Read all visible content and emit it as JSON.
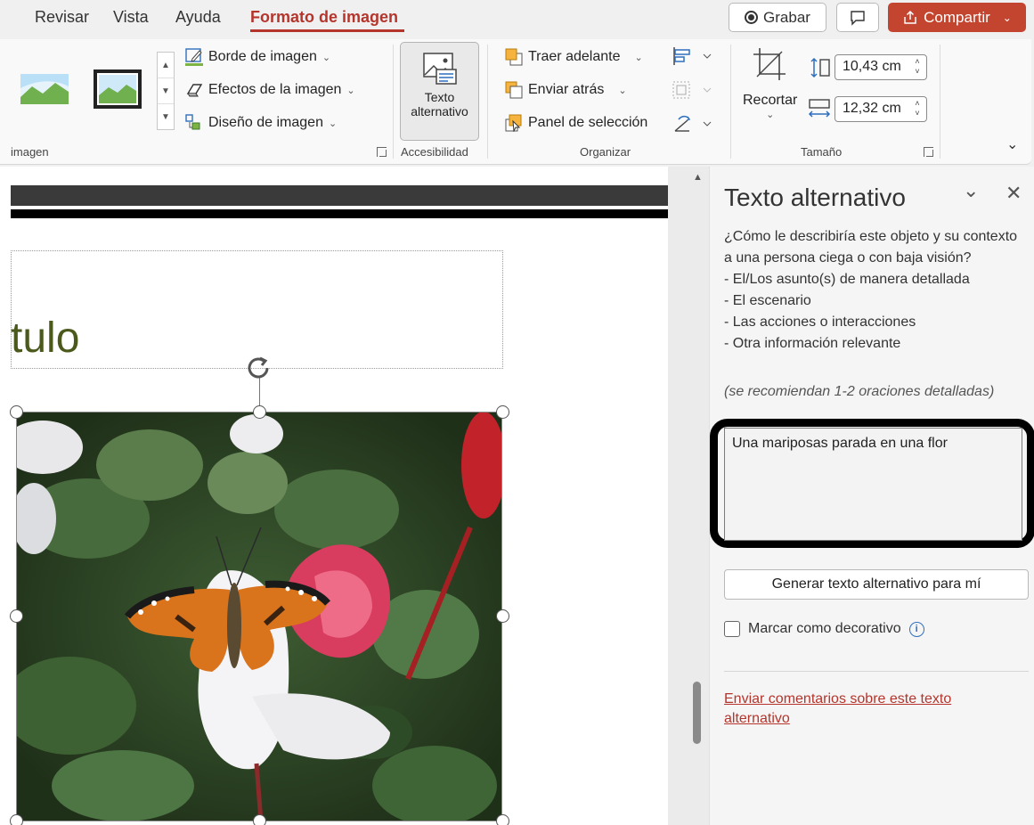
{
  "tabs": [
    {
      "label": "Revisar"
    },
    {
      "label": "Vista"
    },
    {
      "label": "Ayuda"
    },
    {
      "label": "Formato de imagen",
      "active": true
    }
  ],
  "titlebar_buttons": {
    "record_label": "Grabar",
    "share_label": "Compartir"
  },
  "ribbon": {
    "groups": {
      "image_styles_label": "imagen",
      "accessibility_label": "Accesibilidad",
      "arrange_label": "Organizar",
      "size_label": "Tamaño"
    },
    "picture_border": "Borde de imagen",
    "picture_effects": "Efectos de la imagen",
    "picture_layout": "Diseño de imagen",
    "alt_text_line1": "Texto",
    "alt_text_line2": "alternativo",
    "bring_forward": "Traer adelante",
    "send_backward": "Enviar atrás",
    "selection_pane": "Panel de selección",
    "crop": "Recortar",
    "height_value": "10,43 cm",
    "width_value": "12,32 cm"
  },
  "slide": {
    "title_fragment": "tulo"
  },
  "alt_pane": {
    "title": "Texto alternativo",
    "description_lines": [
      "¿Cómo le describiría este objeto y su contexto a una persona ciega o con baja visión?",
      "- El/Los asunto(s) de manera detallada",
      "- El escenario",
      "- Las acciones o interacciones",
      "- Otra información relevante"
    ],
    "hint": "(se recomiendan 1-2 oraciones detalladas)",
    "alt_text_value": "Una mariposas parada en una flor",
    "generate_button": "Generar texto alternativo para mí",
    "decorative_label": "Marcar como decorativo",
    "decorative_checked": false,
    "feedback_link": "Enviar comentarios sobre este texto alternativo"
  },
  "colors": {
    "accent": "#b5352c",
    "share_button": "#c4452f",
    "title_text": "#4b5a1c"
  }
}
